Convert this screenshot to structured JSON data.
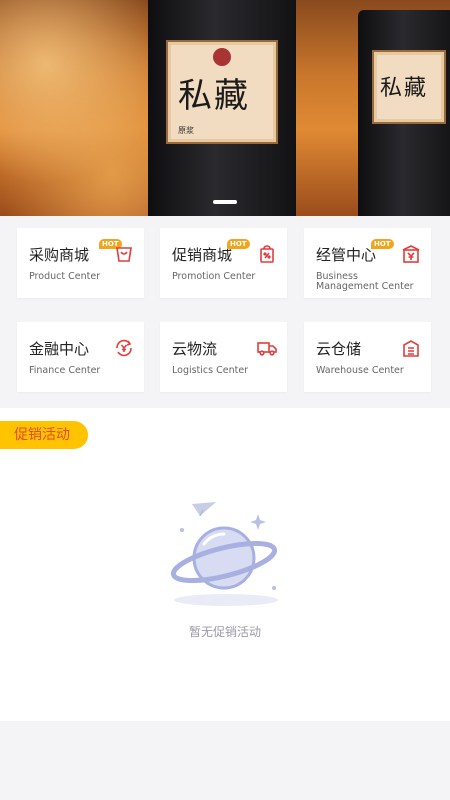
{
  "banner": {
    "bottle_label_text": "私藏",
    "bottle_label_sub": "原浆"
  },
  "categories": [
    {
      "title": "采购商城",
      "subtitle": "Product Center",
      "hot": "HOT",
      "icon": "shopping-bag-icon"
    },
    {
      "title": "促销商城",
      "subtitle": "Promotion Center",
      "hot": "HOT",
      "icon": "discount-bag-icon"
    },
    {
      "title": "经管中心",
      "subtitle": "Business Management Center",
      "hot": "HOT",
      "icon": "yen-building-icon"
    },
    {
      "title": "金融中心",
      "subtitle": "Finance Center",
      "hot": "",
      "icon": "yen-refresh-icon"
    },
    {
      "title": "云物流",
      "subtitle": "Logistics Center",
      "hot": "",
      "icon": "truck-icon"
    },
    {
      "title": "云仓储",
      "subtitle": "Warehouse Center",
      "hot": "",
      "icon": "warehouse-icon"
    }
  ],
  "promo": {
    "tag": "促销活动",
    "empty_text": "暂无促销活动",
    "empty_icon": "planet-empty-icon"
  },
  "colors": {
    "accent_red": "#e43c3c",
    "hot_badge": "#f0a61b",
    "promo_tag_bg": "#ffc300",
    "promo_tag_text": "#e44a2a"
  }
}
